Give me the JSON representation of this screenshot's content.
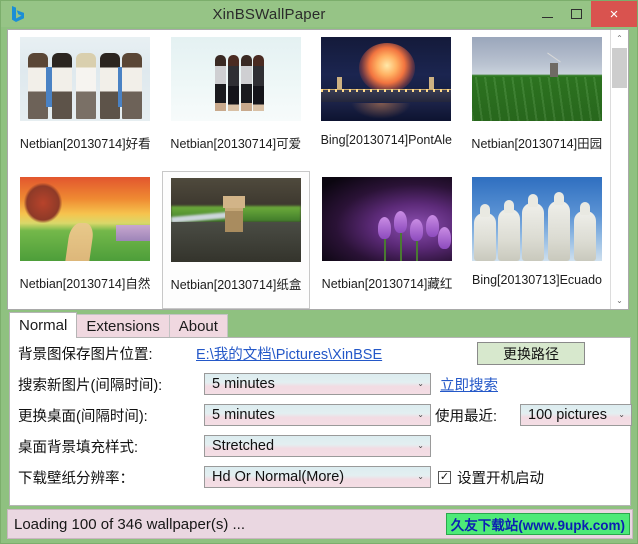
{
  "window": {
    "title": "XinBSWallPaper",
    "app_icon": "bing-logo-icon",
    "minimize_label": "Minimize",
    "maximize_label": "Maximize",
    "close_label": "×"
  },
  "gallery": {
    "rows": [
      [
        {
          "label": "Netbian[20130714]好看",
          "art": "anime",
          "selected": false
        },
        {
          "label": "Netbian[20130714]可爱",
          "art": "girls",
          "selected": false
        },
        {
          "label": "Bing[20130714]PontAle",
          "art": "fireworks",
          "selected": false
        },
        {
          "label": "Netbian[20130714]田园",
          "art": "field",
          "selected": false
        }
      ],
      [
        {
          "label": "Netbian[20130714]自然",
          "art": "sunset",
          "selected": false
        },
        {
          "label": "Netbian[20130714]纸盒",
          "art": "box",
          "selected": true
        },
        {
          "label": "Netbian[20130714]藏红",
          "art": "flower",
          "selected": false
        },
        {
          "label": "Bing[20130713]Ecuado",
          "art": "alpaca",
          "selected": false
        }
      ]
    ],
    "scrollbar": {
      "up_arrow": "⌃",
      "down_arrow": "⌄"
    }
  },
  "tabs": [
    {
      "label": "Normal",
      "active": true
    },
    {
      "label": "Extensions",
      "active": false
    },
    {
      "label": "About",
      "active": false
    }
  ],
  "settings": {
    "save_path_label": "背景图保存图片位置:",
    "save_path_value": "E:\\我的文档\\Pictures\\XinBSE",
    "change_path_button": "更换路径",
    "search_interval_label": "搜索新图片(间隔时间):",
    "search_interval_value": "5 minutes",
    "search_now_link": "立即搜索",
    "change_interval_label": "更换桌面(间隔时间):",
    "change_interval_value": "5 minutes",
    "recent_label": "使用最近:",
    "recent_value": "100 pictures",
    "fill_style_label": "桌面背景填充样式:",
    "fill_style_value": "Stretched",
    "resolution_label": "下载壁纸分辨率：",
    "resolution_value": "Hd Or Normal(More)",
    "startup_label": "设置开机启动",
    "startup_checked": "✓",
    "caret": "⌄"
  },
  "status": {
    "text": "Loading 100 of 346 wallpaper(s) ...",
    "watermark": "久友下载站(www.9upk.com)"
  },
  "colors": {
    "window_frame": "#8fc180",
    "titlebar": "#96c486",
    "close_button": "#d9534f",
    "tab_inactive": "#f0d8e0",
    "statusbar": "#ead7e1",
    "watermark_bg": "#4dea78",
    "watermark_text": "#0b1fb3",
    "link": "#2458c8",
    "button_face": "#d7e8cd"
  }
}
